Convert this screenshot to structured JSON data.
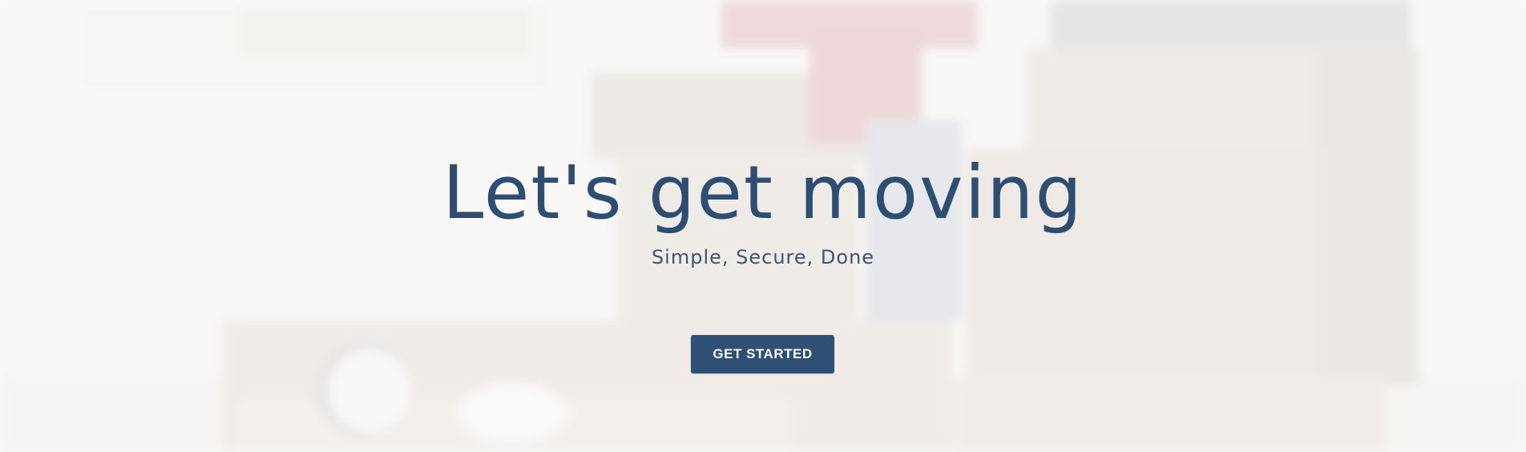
{
  "hero": {
    "headline": "Let's get moving",
    "tagline": "Simple, Secure, Done",
    "cta_label": "GET STARTED",
    "background_image": "blurred-photo-of-people-packing-moving-boxes"
  },
  "colors": {
    "headline": "#2d4d73",
    "tagline": "#3f5670",
    "button_bg": "#2f5074",
    "button_text": "#ffffff"
  }
}
